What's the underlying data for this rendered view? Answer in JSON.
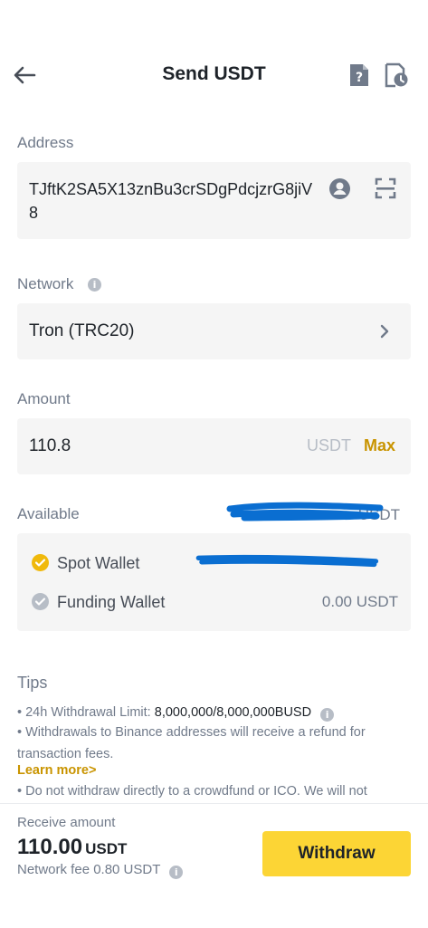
{
  "header": {
    "title": "Send USDT",
    "back_icon": "arrow-left-icon",
    "faq_icon": "faq-document-icon",
    "history_icon": "history-clock-icon"
  },
  "address": {
    "label": "Address",
    "value": "TJftK2SA5X13znBu3crSDgPdcjzrG8jiV8",
    "contact_icon": "address-book-icon",
    "scan_icon": "qr-scan-icon"
  },
  "network": {
    "label": "Network",
    "value": "Tron (TRC20)"
  },
  "amount": {
    "label": "Amount",
    "value": "110.8",
    "unit": "USDT",
    "max_label": "Max"
  },
  "available": {
    "label": "Available",
    "value_suffix": "USDT",
    "wallets": [
      {
        "label": "Spot Wallet",
        "value": "",
        "selected": true
      },
      {
        "label": "Funding Wallet",
        "value": "0.00 USDT",
        "selected": false
      }
    ]
  },
  "tips": {
    "title": "Tips",
    "limit_prefix": "• 24h Withdrawal Limit: ",
    "limit_value": "8,000,000/8,000,000BUSD",
    "refund_text": "• Withdrawals to Binance addresses will receive a refund for transaction fees.",
    "learn_more": "Learn more>",
    "ico_text": "• Do not withdraw directly to a crowdfund or ICO. We will not"
  },
  "footer": {
    "receive_label": "Receive amount",
    "receive_amount": "110.00",
    "receive_unit": "USDT",
    "fee_text": "Network fee 0.80 USDT",
    "withdraw_label": "Withdraw"
  },
  "colors": {
    "accent": "#fcd535",
    "link": "#c99400",
    "redaction": "#0a6ed1",
    "check_selected": "#f0b90b",
    "check_unselected": "#b7bdc6"
  }
}
